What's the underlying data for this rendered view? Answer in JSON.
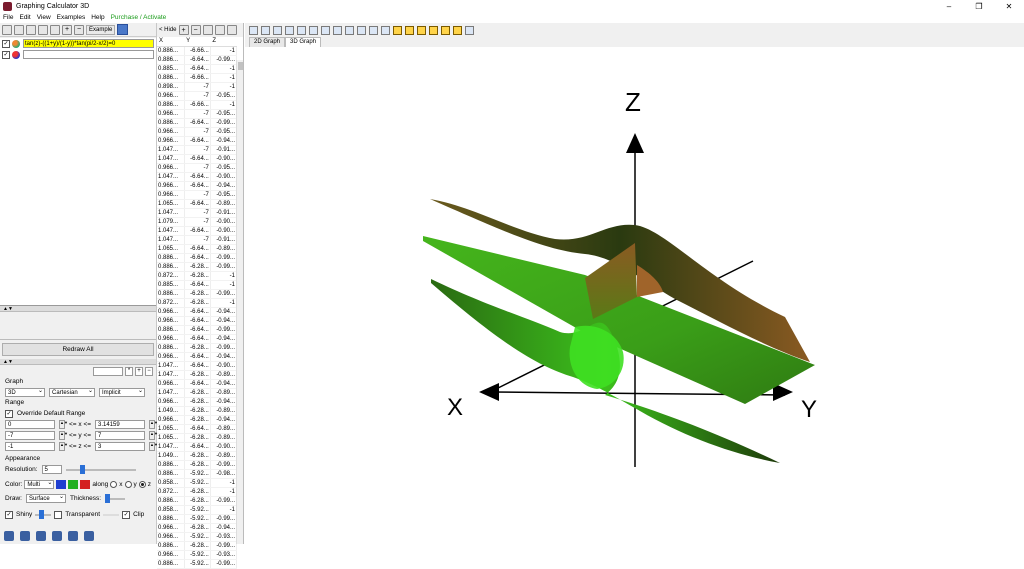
{
  "window": {
    "title": "Graphing Calculator 3D",
    "controls": [
      "–",
      "❐",
      "✕"
    ]
  },
  "menu": {
    "items": [
      "File",
      "Edit",
      "View",
      "Examples",
      "Help"
    ],
    "purchase": "Purchase / Activate"
  },
  "left_toolbar": {
    "example_label": "Example"
  },
  "equations": [
    {
      "text": "tan(z)-((1+y)/(1-y))*tan(pi/2-x/2)=0"
    },
    {
      "text": ""
    }
  ],
  "redraw_label": "Redraw All",
  "graph": {
    "section": "Graph",
    "dimension": "3D",
    "coordinates": "Cartesian",
    "mode": "Implicit"
  },
  "range": {
    "section": "Range",
    "override_label": "Override Default Range",
    "x_min": "0",
    "x_max": "3.14159",
    "y_min": "-7",
    "y_max": "7",
    "z_min": "-1",
    "z_max": "3",
    "x_op": "<= x <=",
    "y_op": "<= y <=",
    "z_op": "<= z <="
  },
  "appearance": {
    "section": "Appearance",
    "resolution_label": "Resolution:",
    "resolution_value": "5",
    "color_label": "Color:",
    "color_value": "Multi",
    "along_label": "along",
    "axis_options": [
      "x",
      "y",
      "z"
    ],
    "draw_label": "Draw:",
    "draw_value": "Surface",
    "thickness_label": "Thickness:",
    "shiny_label": "Shiny",
    "transparent_label": "Transparent",
    "clip_label": "Clip"
  },
  "table_toolbar": {
    "hide_label": "< Hide"
  },
  "table": {
    "headers": [
      "X",
      "Y",
      "Z"
    ],
    "rows": [
      [
        "0.886...",
        "-6.66...",
        "-1"
      ],
      [
        "0.886...",
        "-6.64...",
        "-0.99..."
      ],
      [
        "0.885...",
        "-6.64...",
        "-1"
      ],
      [
        "0.886...",
        "-6.66...",
        "-1"
      ],
      [
        "0.898...",
        "-7",
        "-1"
      ],
      [
        "0.966...",
        "-7",
        "-0.95..."
      ],
      [
        "0.886...",
        "-6.66...",
        "-1"
      ],
      [
        "0.966...",
        "-7",
        "-0.95..."
      ],
      [
        "0.886...",
        "-6.64...",
        "-0.99..."
      ],
      [
        "0.966...",
        "-7",
        "-0.95..."
      ],
      [
        "0.966...",
        "-6.64...",
        "-0.94..."
      ],
      [
        "1.047...",
        "-7",
        "-0.91..."
      ],
      [
        "1.047...",
        "-6.64...",
        "-0.90..."
      ],
      [
        "0.966...",
        "-7",
        "-0.95..."
      ],
      [
        "1.047...",
        "-6.64...",
        "-0.90..."
      ],
      [
        "0.966...",
        "-6.64...",
        "-0.94..."
      ],
      [
        "0.966...",
        "-7",
        "-0.95..."
      ],
      [
        "1.065...",
        "-6.64...",
        "-0.89..."
      ],
      [
        "1.047...",
        "-7",
        "-0.91..."
      ],
      [
        "1.079...",
        "-7",
        "-0.90..."
      ],
      [
        "1.047...",
        "-6.64...",
        "-0.90..."
      ],
      [
        "1.047...",
        "-7",
        "-0.91..."
      ],
      [
        "1.065...",
        "-6.64...",
        "-0.89..."
      ],
      [
        "0.886...",
        "-6.64...",
        "-0.99..."
      ],
      [
        "0.886...",
        "-6.28...",
        "-0.99..."
      ],
      [
        "0.872...",
        "-6.28...",
        "-1"
      ],
      [
        "0.885...",
        "-6.64...",
        "-1"
      ],
      [
        "0.886...",
        "-6.28...",
        "-0.99..."
      ],
      [
        "0.872...",
        "-6.28...",
        "-1"
      ],
      [
        "0.966...",
        "-6.64...",
        "-0.94..."
      ],
      [
        "0.966...",
        "-6.64...",
        "-0.94..."
      ],
      [
        "0.886...",
        "-6.64...",
        "-0.99..."
      ],
      [
        "0.966...",
        "-6.64...",
        "-0.94..."
      ],
      [
        "0.886...",
        "-6.28...",
        "-0.99..."
      ],
      [
        "0.966...",
        "-6.64...",
        "-0.94..."
      ],
      [
        "1.047...",
        "-6.64...",
        "-0.90..."
      ],
      [
        "1.047...",
        "-6.28...",
        "-0.89..."
      ],
      [
        "0.966...",
        "-6.64...",
        "-0.94..."
      ],
      [
        "1.047...",
        "-6.28...",
        "-0.89..."
      ],
      [
        "0.966...",
        "-6.28...",
        "-0.94..."
      ],
      [
        "1.049...",
        "-6.28...",
        "-0.89..."
      ],
      [
        "0.966...",
        "-6.28...",
        "-0.94..."
      ],
      [
        "1.065...",
        "-6.64...",
        "-0.89..."
      ],
      [
        "1.065...",
        "-6.28...",
        "-0.89..."
      ],
      [
        "1.047...",
        "-6.64...",
        "-0.90..."
      ],
      [
        "1.049...",
        "-6.28...",
        "-0.89..."
      ],
      [
        "0.886...",
        "-6.28...",
        "-0.99..."
      ],
      [
        "0.886...",
        "-5.92...",
        "-0.98..."
      ],
      [
        "0.858...",
        "-5.92...",
        "-1"
      ],
      [
        "0.872...",
        "-6.28...",
        "-1"
      ],
      [
        "0.886...",
        "-6.28...",
        "-0.99..."
      ],
      [
        "0.858...",
        "-5.92...",
        "-1"
      ],
      [
        "0.886...",
        "-5.92...",
        "-0.99..."
      ],
      [
        "0.966...",
        "-6.28...",
        "-0.94..."
      ],
      [
        "0.966...",
        "-5.92...",
        "-0.93..."
      ],
      [
        "0.886...",
        "-6.28...",
        "-0.99..."
      ],
      [
        "0.966...",
        "-5.92...",
        "-0.93..."
      ],
      [
        "0.886...",
        "-5.92...",
        "-0.99..."
      ]
    ]
  },
  "graph_tabs": [
    "2D Graph",
    "3D Graph"
  ],
  "axes": {
    "x": "X",
    "y": "Y",
    "z": "Z"
  },
  "colors": {
    "surface_green": "#3cb81c",
    "surface_dark": "#2a4a12",
    "surface_brown": "#8a5a22",
    "purchase": "#1a9b1a"
  }
}
